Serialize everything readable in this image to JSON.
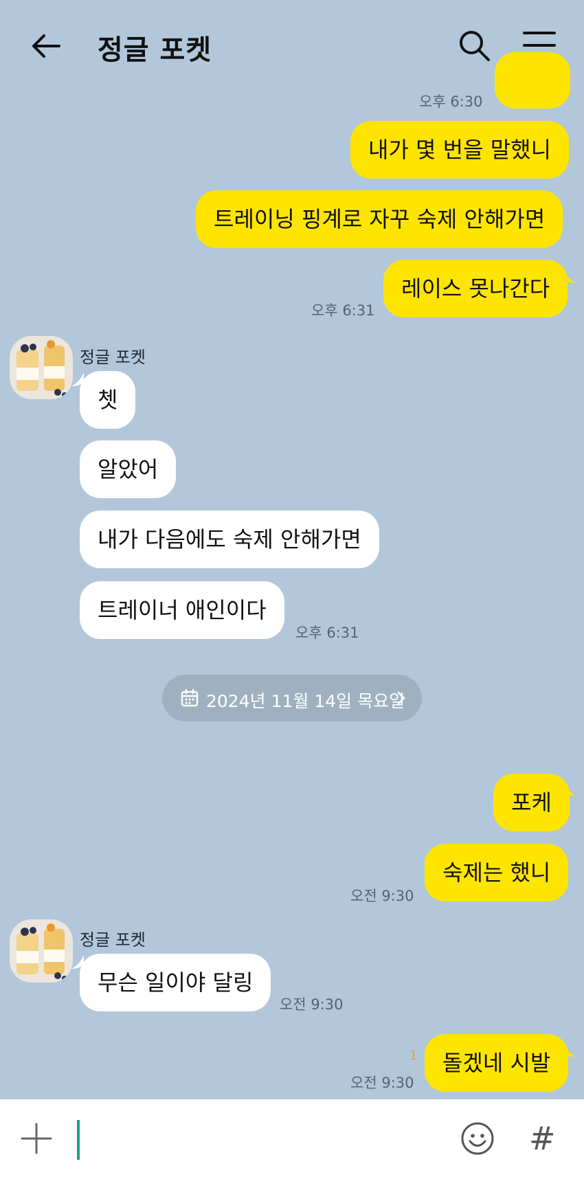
{
  "header": {
    "title": "정글 포켓"
  },
  "messages": {
    "m0_time": "오후 6:30",
    "m1": "내가 몇 번을 말했니",
    "m2": "트레이닝 핑계로 자꾸 숙제 안해가면",
    "m3": "레이스 못나간다",
    "m3_time": "오후 6:31",
    "sender1": "정글 포켓",
    "t1": "쳇",
    "t2": "알았어",
    "t3": "내가 다음에도 숙제 안해가면",
    "t4": "트레이너 애인이다",
    "t4_time": "오후 6:31",
    "date": "2024년 11월 14일 목요일",
    "m4": "포케",
    "m5": "숙제는 했니",
    "m5_time": "오전 9:30",
    "sender2": "정글 포켓",
    "t5": "무슨 일이야 달링",
    "t5_time": "오전 9:30",
    "m6": "돌겠네 시발",
    "m6_unread": "1",
    "m6_time": "오전 9:30"
  },
  "colors": {
    "background": "#b2c7da",
    "my_bubble": "#fee500",
    "their_bubble": "#ffffff"
  },
  "icons": {
    "back": "back-arrow-icon",
    "search": "search-icon",
    "menu": "menu-icon",
    "calendar": "calendar-icon",
    "chevron": "chevron-right-icon",
    "plus": "plus-icon",
    "emoji": "emoji-icon",
    "hash": "#"
  }
}
